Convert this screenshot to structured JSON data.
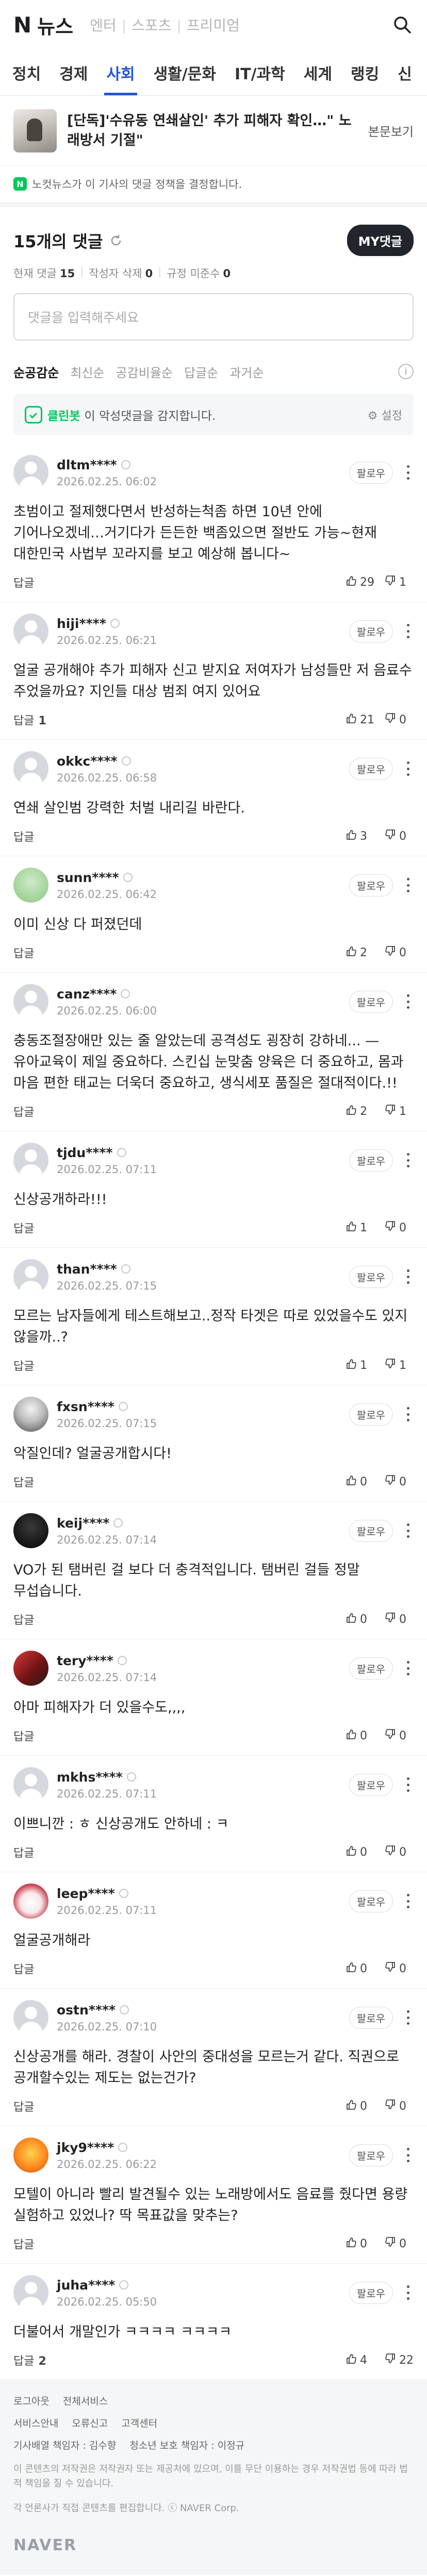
{
  "header": {
    "logo": "N",
    "section": "뉴스",
    "services": [
      "엔터",
      "스포츠",
      "프리미엄"
    ]
  },
  "tabs": [
    "정치",
    "경제",
    "사회",
    "생활/문화",
    "IT/과학",
    "세계",
    "랭킹",
    "신"
  ],
  "active_tab_index": 2,
  "article": {
    "title": "[단독]'수유동 연쇄살인' 추가 피해자 확인…\" 노래방서 기절\"",
    "more_label": "본문보기"
  },
  "notice": {
    "icon_text": "N",
    "text": "노컷뉴스가 이 기사의 댓글 정책을 결정합니다."
  },
  "comment_header": {
    "count_label": "15개의 댓글",
    "my_button": "MY댓글",
    "stats": [
      {
        "label": "현재 댓글",
        "value": "15"
      },
      {
        "label": "작성자 삭제",
        "value": "0"
      },
      {
        "label": "규정 미준수",
        "value": "0"
      }
    ]
  },
  "input": {
    "placeholder": "댓글을 입력해주세요"
  },
  "sort": {
    "options": [
      "순공감순",
      "최신순",
      "공감비율순",
      "답글순",
      "과거순"
    ],
    "active_index": 0
  },
  "cleanbot": {
    "name": "클린봇",
    "text": "이 악성댓글을 감지합니다.",
    "setting": "설정"
  },
  "comments": [
    {
      "nick": "dltm****",
      "date": "2026.02.25. 06:02",
      "text": "초범이고 절제했다면서 반성하는척좀 하면 10년 안에 기어나오겠네…거기다가 든든한 백좀있으면 절반도 가능~현재 대한민국 사법부 꼬라지를 보고 예상해 봅니다~",
      "reply": "답글",
      "reply_count": "",
      "likes": "29",
      "dislikes": "1",
      "avatar": "default"
    },
    {
      "nick": "hiji****",
      "date": "2026.02.25. 06:21",
      "text": "얼굴 공개해야 추가 피해자 신고 받지요 저여자가 남성들만 저 음료수 주었을까요? 지인들 대상 범죄 여지 있어요",
      "reply": "답글",
      "reply_count": "1",
      "likes": "21",
      "dislikes": "0",
      "avatar": "default"
    },
    {
      "nick": "okkc****",
      "date": "2026.02.25. 06:58",
      "text": "연쇄 살인범 강력한 처벌 내리길 바란다.",
      "reply": "답글",
      "reply_count": "",
      "likes": "3",
      "dislikes": "0",
      "avatar": "default"
    },
    {
      "nick": "sunn****",
      "date": "2026.02.25. 06:42",
      "text": "이미 신상 다 퍼졌던데",
      "reply": "답글",
      "reply_count": "",
      "likes": "2",
      "dislikes": "0",
      "avatar": "green"
    },
    {
      "nick": "canz****",
      "date": "2026.02.25. 06:00",
      "text": "충동조절장애만 있는 줄 알았는데 공격성도 굉장히 강하네... — 유아교육이 제일 중요하다. 스킨십 눈맞춤 양육은 더 중요하고, 몸과 마음 편한 태교는 더욱더 중요하고, 생식세포 품질은 절대적이다.!!",
      "reply": "답글",
      "reply_count": "",
      "likes": "2",
      "dislikes": "1",
      "avatar": "default"
    },
    {
      "nick": "tjdu****",
      "date": "2026.02.25. 07:11",
      "text": "신상공개하라!!!",
      "reply": "답글",
      "reply_count": "",
      "likes": "1",
      "dislikes": "0",
      "avatar": "default"
    },
    {
      "nick": "than****",
      "date": "2026.02.25. 07:15",
      "text": "모르는 남자들에게 테스트해보고..정작 타겟은 따로 있었을수도 있지 않을까..?",
      "reply": "답글",
      "reply_count": "",
      "likes": "1",
      "dislikes": "1",
      "avatar": "default"
    },
    {
      "nick": "fxsn****",
      "date": "2026.02.25. 07:15",
      "text": "악질인데? 얼굴공개합시다!",
      "reply": "답글",
      "reply_count": "",
      "likes": "0",
      "dislikes": "0",
      "avatar": "photo"
    },
    {
      "nick": "keij****",
      "date": "2026.02.25. 07:14",
      "text": "VO가 된 탬버린 걸 보다 더 충격적입니다. 탬버린 걸들 정말 무섭습니다.",
      "reply": "답글",
      "reply_count": "",
      "likes": "0",
      "dislikes": "0",
      "avatar": "dark"
    },
    {
      "nick": "tery****",
      "date": "2026.02.25. 07:14",
      "text": "아마 피해자가 더 있을수도,,,,",
      "reply": "답글",
      "reply_count": "",
      "likes": "0",
      "dislikes": "0",
      "avatar": "red"
    },
    {
      "nick": "mkhs****",
      "date": "2026.02.25. 07:11",
      "text": "이쁘니깐 : ㅎ 신상공개도 안하네 : ㅋ",
      "reply": "답글",
      "reply_count": "",
      "likes": "0",
      "dislikes": "0",
      "avatar": "default"
    },
    {
      "nick": "leep****",
      "date": "2026.02.25. 07:11",
      "text": "얼굴공개해라",
      "reply": "답글",
      "reply_count": "",
      "likes": "0",
      "dislikes": "0",
      "avatar": "cake"
    },
    {
      "nick": "ostn****",
      "date": "2026.02.25. 07:10",
      "text": "신상공개를 해라. 경찰이 사안의 중대성을 모르는거 같다. 직권으로 공개할수있는 제도는 없는건가?",
      "reply": "답글",
      "reply_count": "",
      "likes": "0",
      "dislikes": "0",
      "avatar": "default"
    },
    {
      "nick": "jky9****",
      "date": "2026.02.25. 06:22",
      "text": "모텔이 아니라 빨리 발견될수 있는 노래방에서도 음료를 줬다면 용량 실험하고 있었나? 딱 목표값을 맞추는?",
      "reply": "답글",
      "reply_count": "",
      "likes": "0",
      "dislikes": "0",
      "avatar": "orange"
    },
    {
      "nick": "juha****",
      "date": "2026.02.25. 05:50",
      "text": "더불어서 개말인가 ㅋㅋㅋㅋ ㅋㅋㅋㅋ",
      "reply": "답글",
      "reply_count": "2",
      "likes": "4",
      "dislikes": "22",
      "avatar": "default"
    }
  ],
  "comment_ui": {
    "follow": "팔로우"
  },
  "footer": {
    "row1": [
      "로그아웃",
      "전체서비스"
    ],
    "row2": [
      "서비스안내",
      "오류신고",
      "고객센터"
    ],
    "row3": [
      "기사배열 책임자 : 김수향",
      "청소년 보호 책임자 : 이정규"
    ],
    "note": "이 콘텐츠의 저작권은 저작권자 또는 제공처에 있으며, 이를 무단 이용하는 경우 저작권법 등에 따라 법적 책임을 질 수 있습니다.",
    "ai_note": "각 언론사가 직접 콘텐츠를 편집합니다. ⓒ NAVER Corp.",
    "brand": "NAVER"
  },
  "colors": {
    "accent": "#2256d6",
    "green": "#03c75a",
    "dark_button": "#22252c"
  }
}
